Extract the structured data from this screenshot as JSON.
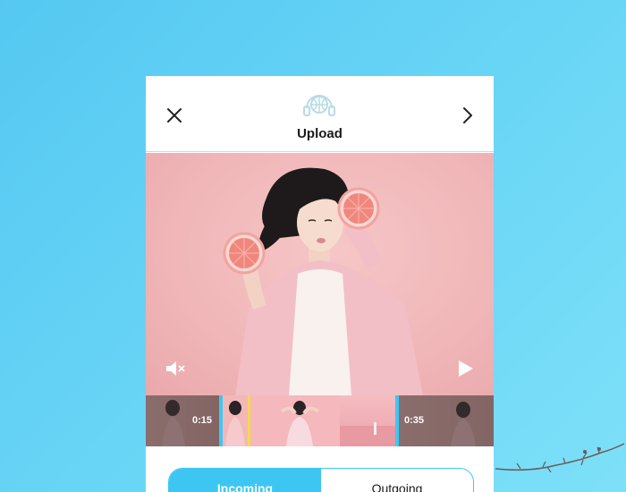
{
  "header": {
    "title": "Upload"
  },
  "icons": {
    "close": "close-icon",
    "next": "chevron-right-icon",
    "logo": "globe-headphones-icon",
    "mute": "mute-icon",
    "play": "play-icon"
  },
  "timeline": {
    "start_time": "0:15",
    "end_time": "0:35"
  },
  "tabs": [
    {
      "label": "Incoming",
      "active": true
    },
    {
      "label": "Outgoing",
      "active": false
    }
  ],
  "colors": {
    "accent": "#3ec6f2",
    "background": "#5ccbf3",
    "preview_bg": "#f0b6b8"
  }
}
